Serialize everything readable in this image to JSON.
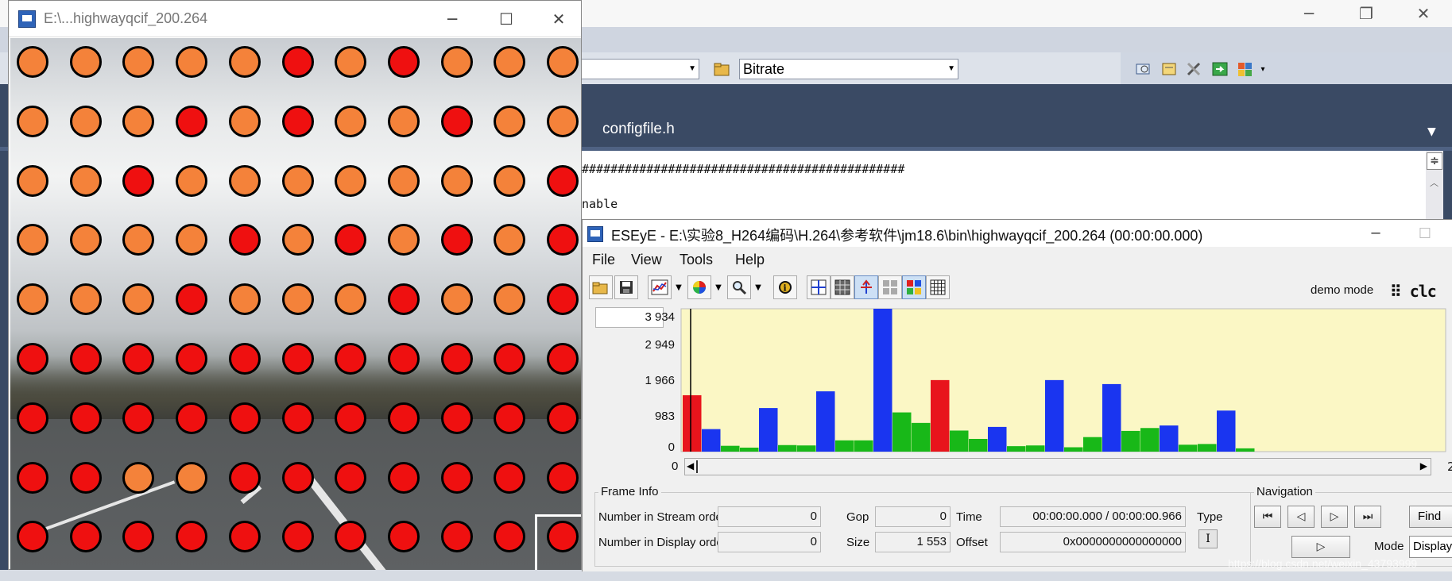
{
  "ide": {
    "combo_left_value": "",
    "combo_right_value": "Bitrate",
    "tab_title": "configfile.h",
    "editor_lines": [
      "#############################################",
      "nable"
    ]
  },
  "video_window": {
    "title": "E:\\...highwayqcif_200.264",
    "grid_cols": 11,
    "grid_rows": 9,
    "dot_colors": {
      "inter": "#f4823a",
      "intra": "#ef1010"
    },
    "dot_pattern": [
      "OOOOOROROOO",
      "OOOROROOROO",
      "OOROOOOOOOR",
      "OOOOROROROR",
      "OOOROOOROOR",
      "RRRRRRRRRRR",
      "RRRRRRRRRRR",
      "RROORRRRRRR",
      "RRRRRRRRRRR"
    ]
  },
  "eseye": {
    "title": "ESEyE - E:\\实验8_H264编码\\H.264\\参考软件\\jm18.6\\bin\\highwayqcif_200.264 (00:00:00.000)",
    "menu": [
      "File",
      "View",
      "Tools",
      "Help"
    ],
    "demo_mode": "demo mode",
    "logo": "⠿ clc",
    "right_cut_label": "2",
    "frame_info": {
      "legend": "Frame Info",
      "num_stream_label": "Number in Stream order",
      "num_stream_value": "0",
      "num_display_label": "Number in Display order",
      "num_display_value": "0",
      "gop_label": "Gop",
      "gop_value": "0",
      "size_label": "Size",
      "size_value": "1 553",
      "time_label": "Time",
      "time_value": "00:00:00.000 / 00:00:00.966",
      "offset_label": "Offset",
      "offset_value": "0x0000000000000000",
      "type_label": "Type",
      "type_value": "I"
    },
    "navigation": {
      "legend": "Navigation",
      "find_label": "Find",
      "mode_label": "Mode",
      "mode_value": "Display"
    }
  },
  "watermark": "https://blog.csdn.net/weixin_43793999",
  "chart_data": {
    "type": "bar",
    "title": "",
    "ylim": [
      0,
      3934
    ],
    "ytick_labels": [
      "3 934",
      "2 949",
      "1 966",
      "983",
      "0"
    ],
    "ytick_values": [
      3934,
      2949,
      1966,
      983,
      0
    ],
    "x_axis_label": "0",
    "background": "#fbf7c5",
    "frame_type_colors": {
      "I": "#e8141c",
      "P": "#1a35f0",
      "B": "#18b818"
    },
    "frame_types": [
      "I",
      "P",
      "B",
      "B",
      "P",
      "B",
      "B",
      "P",
      "B",
      "B",
      "P",
      "B",
      "B",
      "I",
      "B",
      "B",
      "P",
      "B",
      "B",
      "P",
      "B",
      "B",
      "P",
      "B",
      "B",
      "P",
      "B",
      "B",
      "P",
      "B"
    ],
    "values": [
      1553,
      620,
      160,
      110,
      1200,
      180,
      170,
      1660,
      310,
      310,
      3934,
      1080,
      790,
      1970,
      580,
      350,
      680,
      150,
      170,
      1970,
      120,
      400,
      1860,
      570,
      650,
      720,
      190,
      210,
      1130,
      90
    ]
  }
}
